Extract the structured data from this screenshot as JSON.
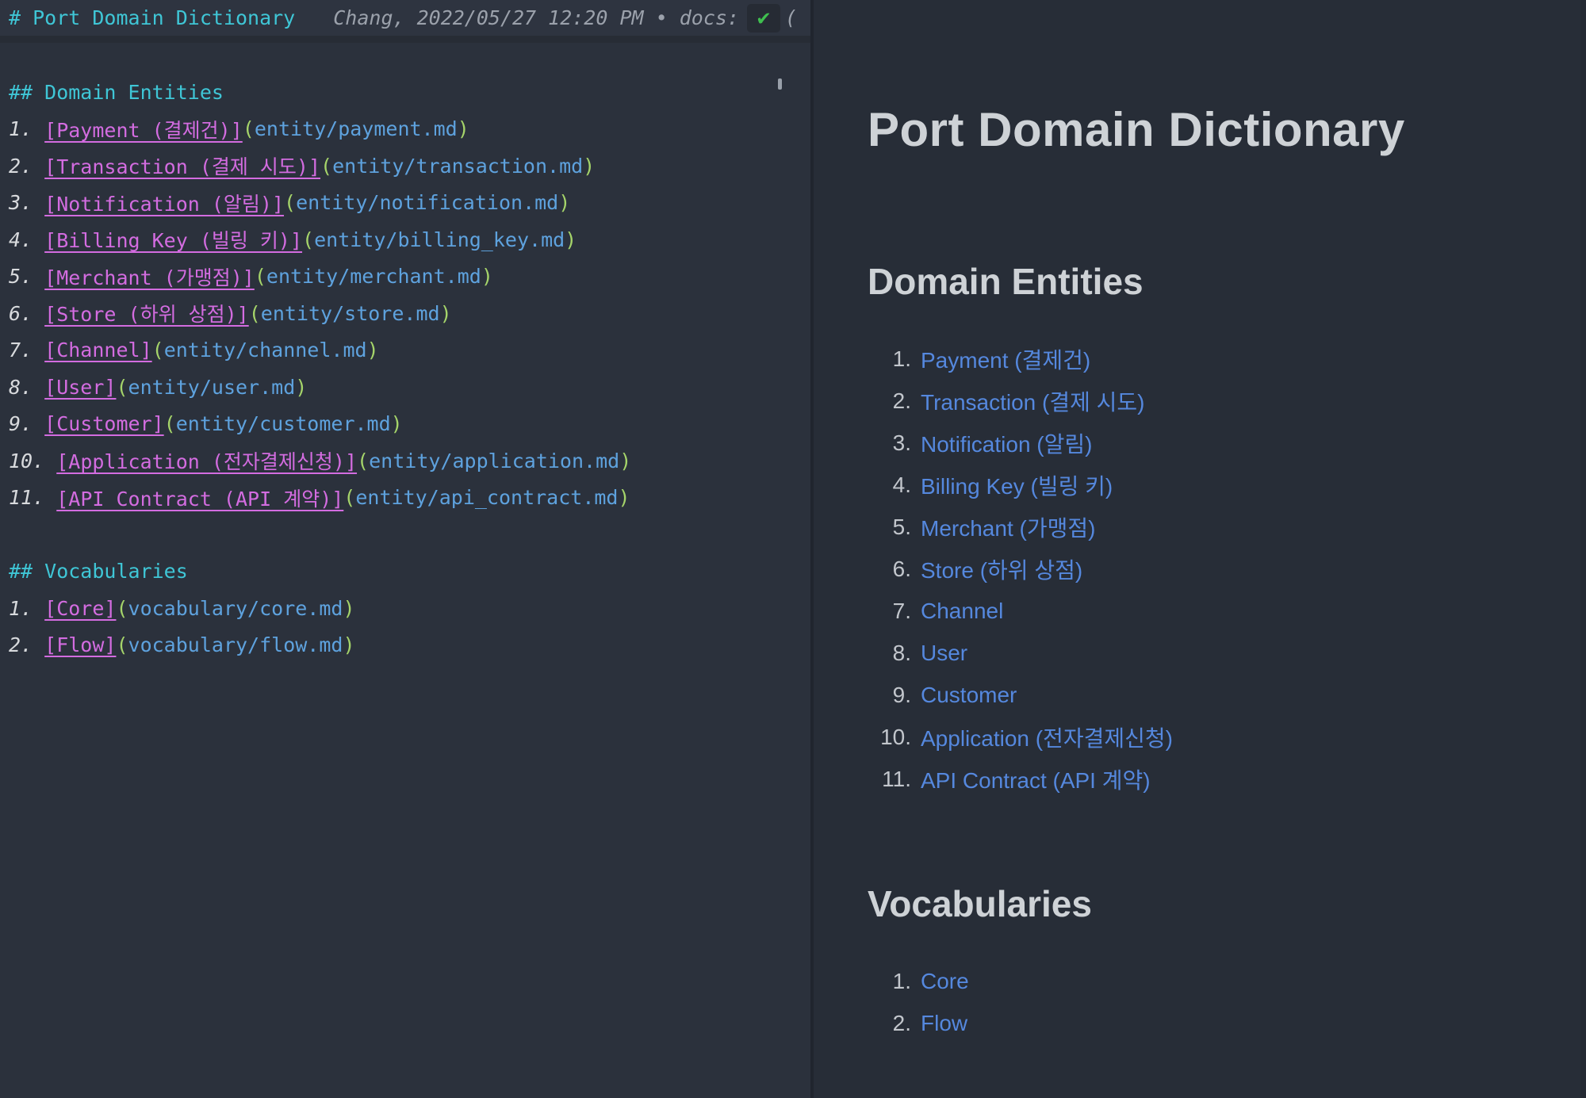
{
  "source": {
    "title_line": "# Port Domain Dictionary",
    "meta": "Chang, 2022/05/27 12:20 PM • docs:",
    "check_icon": "✔",
    "meta_paren": "(",
    "open_paren": "(",
    "close_paren": ")",
    "sections": [
      {
        "heading": "## Domain Entities",
        "items": [
          {
            "num": "1. ",
            "link": "[Payment (결제건)]",
            "target": "entity/payment.md"
          },
          {
            "num": "2. ",
            "link": "[Transaction (결제 시도)]",
            "target": "entity/transaction.md"
          },
          {
            "num": "3. ",
            "link": "[Notification (알림)]",
            "target": "entity/notification.md"
          },
          {
            "num": "4. ",
            "link": "[Billing Key (빌링 키)]",
            "target": "entity/billing_key.md"
          },
          {
            "num": "5. ",
            "link": "[Merchant (가맹점)]",
            "target": "entity/merchant.md"
          },
          {
            "num": "6. ",
            "link": "[Store (하위 상점)]",
            "target": "entity/store.md"
          },
          {
            "num": "7. ",
            "link": "[Channel]",
            "target": "entity/channel.md"
          },
          {
            "num": "8. ",
            "link": "[User]",
            "target": "entity/user.md"
          },
          {
            "num": "9. ",
            "link": "[Customer]",
            "target": "entity/customer.md"
          },
          {
            "num": "10. ",
            "link": "[Application (전자결제신청)]",
            "target": "entity/application.md"
          },
          {
            "num": "11. ",
            "link": "[API Contract (API 계약)]",
            "target": "entity/api_contract.md"
          }
        ]
      },
      {
        "heading": "## Vocabularies",
        "items": [
          {
            "num": "1. ",
            "link": "[Core]",
            "target": "vocabulary/core.md"
          },
          {
            "num": "2. ",
            "link": "[Flow]",
            "target": "vocabulary/flow.md"
          }
        ]
      }
    ]
  },
  "preview": {
    "title": "Port Domain Dictionary",
    "sections": [
      {
        "heading": "Domain Entities",
        "items": [
          {
            "num": "1.",
            "label": "Payment (결제건)"
          },
          {
            "num": "2.",
            "label": "Transaction (결제 시도)"
          },
          {
            "num": "3.",
            "label": "Notification (알림)"
          },
          {
            "num": "4.",
            "label": "Billing Key (빌링 키)"
          },
          {
            "num": "5.",
            "label": "Merchant (가맹점)"
          },
          {
            "num": "6.",
            "label": "Store (하위 상점)"
          },
          {
            "num": "7.",
            "label": "Channel"
          },
          {
            "num": "8.",
            "label": "User"
          },
          {
            "num": "9.",
            "label": "Customer"
          },
          {
            "num": "10.",
            "label": "Application (전자결제신청)"
          },
          {
            "num": "11.",
            "label": "API Contract (API 계약)"
          }
        ]
      },
      {
        "heading": "Vocabularies",
        "items": [
          {
            "num": "1.",
            "label": "Core"
          },
          {
            "num": "2.",
            "label": "Flow"
          }
        ]
      }
    ]
  },
  "colors": {
    "left_bg": "#2b313c",
    "right_bg": "#272d37",
    "heading_cyan": "#3fc6d6",
    "link_magenta": "#d36ce0",
    "paren_green": "#a5d46a",
    "path_blue": "#5ea2de",
    "meta_gray": "#9ba1ab",
    "check_green": "#3fbf4f",
    "preview_heading_gray": "#ced2d6",
    "preview_link_blue": "#5588de"
  }
}
